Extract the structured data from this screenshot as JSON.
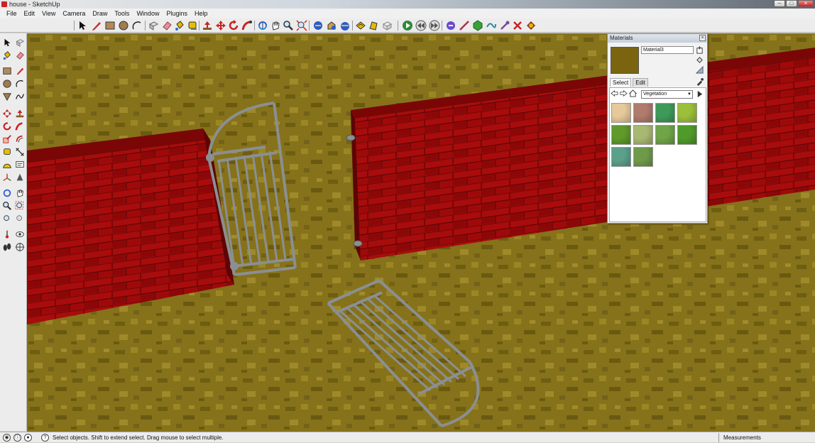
{
  "window": {
    "title": "house - SketchUp",
    "icon": "sketchup-icon"
  },
  "menu": [
    "File",
    "Edit",
    "View",
    "Camera",
    "Draw",
    "Tools",
    "Window",
    "Plugins",
    "Help"
  ],
  "materials": {
    "title": "Materials",
    "material_name": "Material3",
    "tabs": [
      "Select",
      "Edit"
    ],
    "collection": "Vegetation",
    "preview_color": "#7a6410",
    "swatch_colors": [
      "#e6c99a",
      "#b07a6c",
      "#3f9a5a",
      "#9bbf3a",
      "#5f9a2a",
      "#a8b870",
      "#6fa448",
      "#4f9a2a",
      "#5aa08a",
      "#6f9a4a"
    ]
  },
  "colors": {
    "brick": "#9a0a0a",
    "ground": "#86721a",
    "fence": "#8a8f92"
  },
  "status": {
    "message": "Select objects. Shift to extend select. Drag mouse to select multiple.",
    "measurements_label": "Measurements"
  }
}
